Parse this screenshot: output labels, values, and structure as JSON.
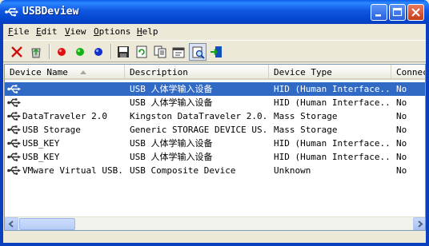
{
  "window": {
    "title": "USBDeview"
  },
  "menu": [
    {
      "label": "File",
      "accel": "F",
      "rest": "ile"
    },
    {
      "label": "Edit",
      "accel": "E",
      "rest": "dit"
    },
    {
      "label": "View",
      "accel": "V",
      "rest": "iew"
    },
    {
      "label": "Options",
      "accel": "O",
      "rest": "ptions"
    },
    {
      "label": "Help",
      "accel": "H",
      "rest": "elp"
    }
  ],
  "toolbar": {
    "icons": [
      "delete-icon",
      "recycle-icon",
      "red-dot-icon",
      "green-dot-icon",
      "blue-dot-icon",
      "save-icon",
      "refresh-icon",
      "copy-icon",
      "properties-icon",
      "find-icon",
      "exit-icon"
    ],
    "colors": {
      "red": "#E01010",
      "green": "#18B018",
      "blue": "#1030D0"
    }
  },
  "list": {
    "columns": [
      "Device Name",
      "Description",
      "Device Type",
      "Connec"
    ],
    "rows": [
      {
        "name": "",
        "description": "USB 人体学输入设备",
        "type": "HID (Human Interface...",
        "connected": "No",
        "selected": true
      },
      {
        "name": "",
        "description": "USB 人体学输入设备",
        "type": "HID (Human Interface...",
        "connected": "No"
      },
      {
        "name": "DataTraveler 2.0",
        "description": "Kingston DataTraveler 2.0...",
        "type": "Mass Storage",
        "connected": "No"
      },
      {
        "name": "USB Storage",
        "description": "Generic STORAGE DEVICE US...",
        "type": "Mass Storage",
        "connected": "No"
      },
      {
        "name": "USB_KEY",
        "description": "USB 人体学输入设备",
        "type": "HID (Human Interface...",
        "connected": "No"
      },
      {
        "name": "USB_KEY",
        "description": "USB 人体学输入设备",
        "type": "HID (Human Interface...",
        "connected": "No"
      },
      {
        "name": "VMware Virtual USB...",
        "description": "USB Composite Device",
        "type": "Unknown",
        "connected": "No"
      }
    ]
  },
  "colors": {
    "selection": "#316AC5",
    "titlebar": "#0A5FE8"
  }
}
